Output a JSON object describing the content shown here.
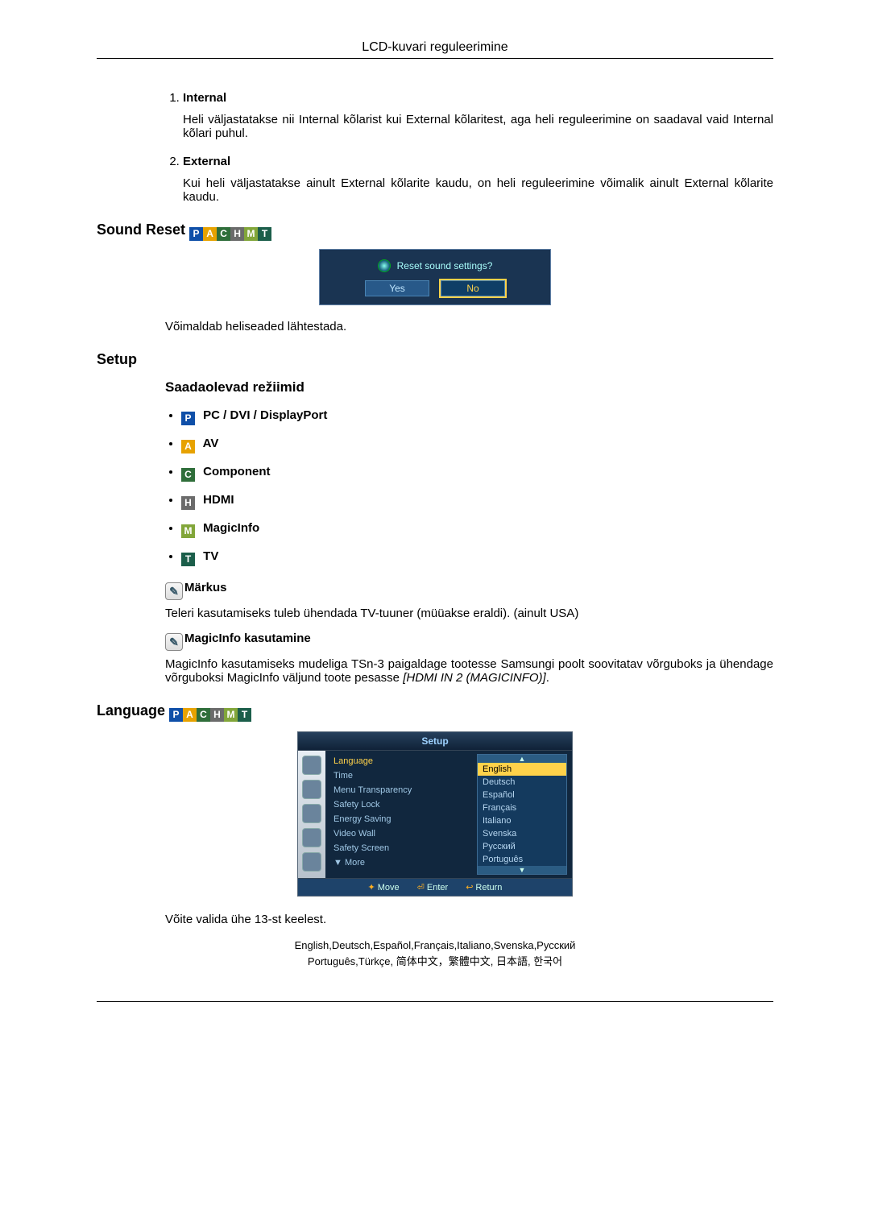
{
  "header": {
    "title": "LCD-kuvari reguleerimine"
  },
  "numbered": [
    {
      "title": "Internal",
      "body": "Heli väljastatakse nii Internal kõlarist kui External kõlaritest, aga heli reguleerimine on saadaval vaid Internal kõlari puhul."
    },
    {
      "title": "External",
      "body": "Kui heli väljastatakse ainult External kõlarite kaudu, on heli reguleerimine võimalik ainult External kõlarite kaudu."
    }
  ],
  "sound_reset": {
    "title": "Sound Reset",
    "osd_question": "Reset sound settings?",
    "osd_yes": "Yes",
    "osd_no": "No",
    "desc": "Võimaldab heliseaded lähtestada."
  },
  "setup": {
    "title": "Setup",
    "modes_heading": "Saadaolevad režiimid",
    "modes": [
      {
        "badge": "P",
        "label": " PC / DVI / DisplayPort"
      },
      {
        "badge": "A",
        "label": " AV"
      },
      {
        "badge": "C",
        "label": " Component"
      },
      {
        "badge": "H",
        "label": " HDMI"
      },
      {
        "badge": "M",
        "label": " MagicInfo"
      },
      {
        "badge": "T",
        "label": " TV"
      }
    ],
    "note_label": "Märkus",
    "note_body": "Teleri kasutamiseks tuleb ühendada TV-tuuner (müüakse eraldi). (ainult USA)",
    "magic_label": "MagicInfo kasutamine",
    "magic_body_prefix": "MagicInfo kasutamiseks mudeliga TSn-3 paigaldage tootesse Samsungi poolt soovitatav võrguboks ja ühendage võrguboksi MagicInfo väljund toote pesasse ",
    "magic_body_italic": "[HDMI IN 2 (MAGICINFO)]",
    "magic_body_suffix": "."
  },
  "language": {
    "title": "Language ",
    "osd": {
      "title": "Setup",
      "menu_items": [
        "Language",
        "Time",
        "Menu Transparency",
        "Safety Lock",
        "Energy Saving",
        "Video Wall",
        "Safety Screen",
        "▼ More"
      ],
      "options": [
        "English",
        "Deutsch",
        "Español",
        "Français",
        "Italiano",
        "Svenska",
        "Русский",
        "Português"
      ],
      "arrow_up": "▲",
      "arrow_down": "▼",
      "foot": {
        "move": "Move",
        "enter": "Enter",
        "return": "Return"
      }
    },
    "desc": "Võite valida ühe 13-st keelest.",
    "list_line1": "English,Deutsch,Español,Français,Italiano,Svenska,Русский",
    "list_line2": "Português,Türkçe, 简体中文，繁體中文, 日本語, 한국어"
  },
  "badges": {
    "P": "P",
    "A": "A",
    "C": "C",
    "H": "H",
    "M": "M",
    "T": "T"
  }
}
